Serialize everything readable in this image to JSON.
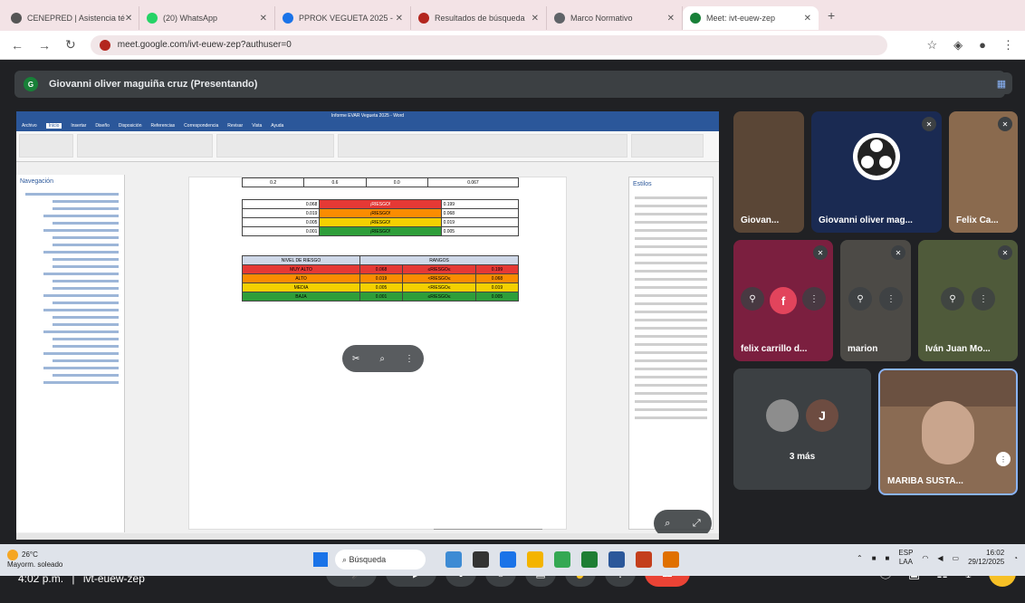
{
  "browser": {
    "tabs": [
      {
        "title": "CENEPRED | Asistencia té",
        "color": "#555"
      },
      {
        "title": "(20) WhatsApp",
        "color": "#25d366"
      },
      {
        "title": "PPROK VEGUETA 2025 -",
        "color": "#1a73e8"
      },
      {
        "title": "Resultados de búsqueda",
        "color": "#b3261e"
      },
      {
        "title": "Marco Normativo",
        "color": "#5f6368"
      },
      {
        "title": "Meet: ivt-euew-zep",
        "color": "#188038"
      }
    ],
    "url": "meet.google.com/ivt-euew-zep?authuser=0"
  },
  "meet": {
    "presenter_label": "Giovanni oliver maguiña cruz (Presentando)",
    "presenter_initial": "G",
    "time": "4:02 p.m.",
    "separator": "|",
    "meeting_code": "ivt-euew-zep",
    "participants": [
      {
        "name": "Giovan..."
      },
      {
        "name": "Giovanni oliver mag..."
      },
      {
        "name": "Felix Ca..."
      },
      {
        "name": "felix carrillo d..."
      },
      {
        "name": "marion"
      },
      {
        "name": "Iván Juan Mo..."
      },
      {
        "name": "MARIBA SUSTA..."
      }
    ],
    "more_label": "3 más",
    "more_avatar_initial": "J",
    "felix_avatar_initial": "f",
    "pip_more": "⋮",
    "controls": [
      "⋯",
      "🎤",
      "⌃",
      "▶",
      "⬆",
      "☺",
      "▤",
      "✋",
      "⋮",
      "☎"
    ],
    "right_controls": [
      "ⓘ",
      "▣",
      "☷",
      "♣"
    ]
  },
  "word": {
    "title_bar": "Informe EVAR Vegueta 2025 - Word",
    "menu_items": [
      "Archivo",
      "Inicio",
      "Insertar",
      "Diseño",
      "Disposición",
      "Referencias",
      "Correspondencia",
      "Revisar",
      "Vista",
      "Ayuda"
    ],
    "nav_title": "Navegación",
    "styles_title": "Estilos",
    "top_table": [
      [
        "0.068",
        "¡RIESGO!",
        "0.199"
      ],
      [
        "0.019",
        "¡RIESGO!",
        "0.068"
      ],
      [
        "0.005",
        "¡RIESGO!",
        "0.019"
      ],
      [
        "0.001",
        "¡RIESGO!",
        "0.005"
      ]
    ],
    "risk_header": [
      "NIVEL DE RIESGO",
      "RANGOS"
    ],
    "risk_rows": [
      {
        "level": "MUY ALTO",
        "a": "0.068",
        "b": "≤RIESGO≤",
        "c": "0.199",
        "color": "#e53935"
      },
      {
        "level": "ALTO",
        "a": "0.019",
        "b": "<RIESGO≤",
        "c": "0.068",
        "color": "#fb8c00"
      },
      {
        "level": "MEDIA",
        "a": "0.005",
        "b": "<RIESGO≤",
        "c": "0.019",
        "color": "#f4d000"
      },
      {
        "level": "BAJA",
        "a": "0.001",
        "b": "≤RIESGO≤",
        "c": "0.005",
        "color": "#2e9e3a"
      }
    ],
    "header_cells": [
      "0.2",
      "0.6",
      "0.0",
      "0.067"
    ]
  },
  "taskbar": {
    "temp": "26°C",
    "weather": "Mayorm. soleado",
    "search": "Búsqueda",
    "lang": "ESP",
    "lang2": "LAA",
    "clock_time": "16:02",
    "clock_date": "29/12/2025"
  },
  "colors": {
    "tab_bg": "#f3e3e6",
    "meet_bg": "#202124",
    "end_call": "#ea4335"
  }
}
